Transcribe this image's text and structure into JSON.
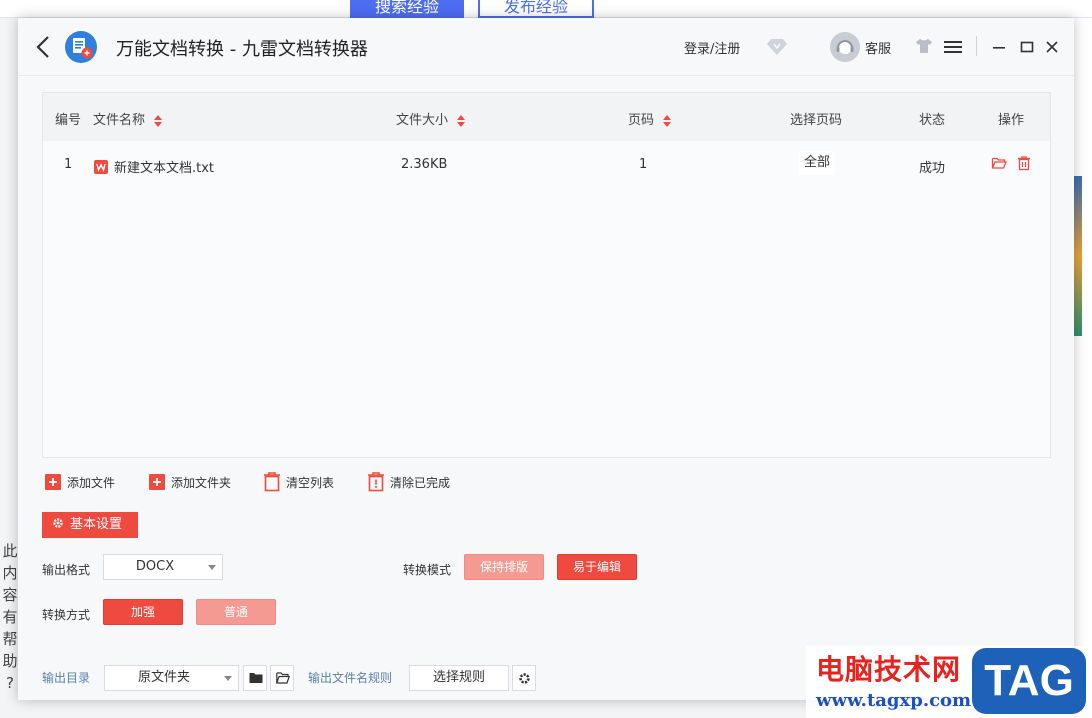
{
  "background": {
    "tabs": [
      "搜索经验",
      "发布经验"
    ],
    "side_text": [
      "此",
      "内",
      "容",
      "有",
      "帮",
      "助",
      "?"
    ],
    "watermark": {
      "cn": "电脑技术网",
      "url": "www.tagxp.com",
      "tag": "TAG"
    }
  },
  "titlebar": {
    "title": "万能文档转换 - 九雷文档转换器",
    "login": "登录/注册",
    "service": "客服"
  },
  "table": {
    "headers": {
      "index": "编号",
      "name": "文件名称",
      "size": "文件大小",
      "pages": "页码",
      "select_pages": "选择页码",
      "status": "状态",
      "actions": "操作"
    },
    "rows": [
      {
        "index": "1",
        "name": "新建文本文档.txt",
        "size": "2.36KB",
        "pages": "1",
        "select_pages": "全部",
        "status": "成功"
      }
    ]
  },
  "actions": {
    "add_file": "添加文件",
    "add_folder": "添加文件夹",
    "clear_list": "清空列表",
    "clear_done": "清除已完成"
  },
  "settings": {
    "tab_label": "基本设置",
    "output_format_label": "输出格式",
    "output_format_value": "DOCX",
    "convert_mode_label": "转换模式",
    "mode_keep_layout": "保持排版",
    "mode_easy_edit": "易于编辑",
    "convert_method_label": "转换方式",
    "method_enhanced": "加强",
    "method_normal": "普通",
    "output_dir_label": "输出目录",
    "output_dir_value": "原文件夹",
    "filename_rule_label": "输出文件名规则",
    "filename_rule_button": "选择规则"
  },
  "colors": {
    "accent": "#ef4a3f",
    "accent_light": "#f59a92",
    "window_bg": "#f6f8fa"
  }
}
